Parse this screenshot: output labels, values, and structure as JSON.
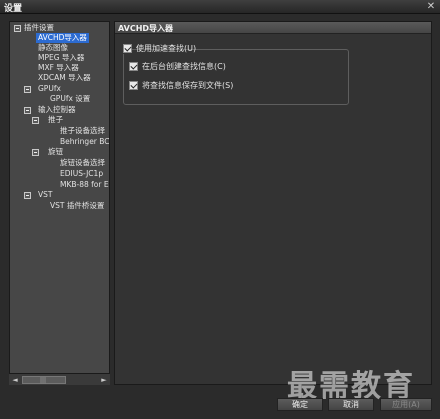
{
  "window": {
    "title": "设置",
    "close_icon": "close-icon"
  },
  "tree": {
    "items": [
      {
        "label": "插件设置"
      },
      {
        "label": "AVCHD导入器"
      },
      {
        "label": "静态图像"
      },
      {
        "label": "MPEG 导入器"
      },
      {
        "label": "MXF 导入器"
      },
      {
        "label": "XDCAM 导入器"
      },
      {
        "label": "GPUfx"
      },
      {
        "label": "GPUfx 设置"
      },
      {
        "label": "输入控制器"
      },
      {
        "label": "推子"
      },
      {
        "label": "推子设备选择"
      },
      {
        "label": "Behringer BCF"
      },
      {
        "label": "旋钮"
      },
      {
        "label": "旋钮设备选择"
      },
      {
        "label": "EDIUS-JC1p"
      },
      {
        "label": "MKB-88 for ED"
      },
      {
        "label": "VST"
      },
      {
        "label": "VST 插件桥设置"
      }
    ]
  },
  "scrollbar": {
    "left_arrow": "◄",
    "right_arrow": "►",
    "grip": "|||"
  },
  "content": {
    "header": "AVCHD导入器",
    "options": {
      "accelerate": "使用加速查找(U)",
      "background": "在后台创建查找信息(C)",
      "save_to_file": "将查找信息保存到文件(S)"
    }
  },
  "buttons": {
    "ok": "确定",
    "cancel": "取消",
    "apply": "应用(A)"
  },
  "watermark": "最需教育",
  "colors": {
    "selection": "#2c6bd1",
    "background": "#2b2b2b"
  }
}
